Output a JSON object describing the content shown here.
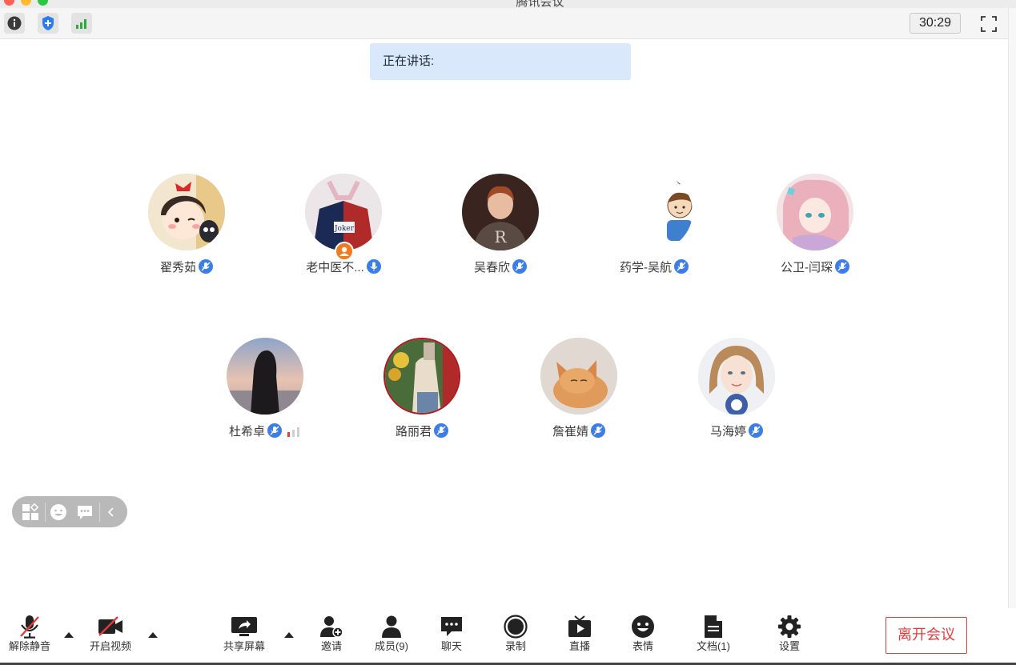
{
  "window": {
    "title": "腾讯会议"
  },
  "topbar": {
    "info_icon": "info-icon",
    "security_icon": "shield-icon",
    "network_icon": "signal-icon",
    "timer": "30:29",
    "fullscreen_icon": "fullscreen-icon"
  },
  "speaking": {
    "label": "正在讲话:"
  },
  "participants": [
    {
      "name": "翟秀茹",
      "mic": "muted"
    },
    {
      "name": "老中医不...",
      "mic": "on",
      "host": true
    },
    {
      "name": "吴春欣",
      "mic": "muted"
    },
    {
      "name": "药学-吴航",
      "mic": "muted"
    },
    {
      "name": "公卫-闫琛",
      "mic": "muted"
    },
    {
      "name": "杜希卓",
      "mic": "muted",
      "weak_network": true
    },
    {
      "name": "路丽君",
      "mic": "muted"
    },
    {
      "name": "詹崔婧",
      "mic": "muted"
    },
    {
      "name": "马海婷",
      "mic": "muted"
    }
  ],
  "floating_toolbar": {
    "items": [
      "layout-icon",
      "emoji-icon",
      "chat-bubble-icon",
      "collapse-icon"
    ]
  },
  "toolbar": {
    "unmute": "解除静音",
    "start_video": "开启视频",
    "share_screen": "共享屏幕",
    "invite": "邀请",
    "members": "成员(9)",
    "chat": "聊天",
    "record": "录制",
    "live": "直播",
    "reactions": "表情",
    "docs": "文档(1)",
    "settings": "设置",
    "leave": "离开会议"
  },
  "colors": {
    "accent_blue": "#3b7ee9",
    "leave_red": "#e63b3b",
    "speaking_bg": "#d9e8fb"
  }
}
